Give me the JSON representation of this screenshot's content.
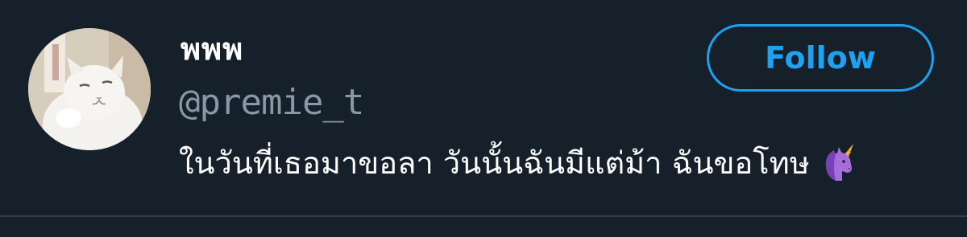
{
  "user": {
    "display_name": "พพพ",
    "handle": "@premie_t",
    "avatar_icon": "cat-avatar"
  },
  "actions": {
    "follow_label": "Follow"
  },
  "tweet": {
    "text": "ในวันที่เธอมาขอลา วันนั้นฉันมีแต่ม้า ฉันขอโทษ",
    "emoji": "unicorn-icon"
  },
  "colors": {
    "background": "#15202b",
    "accent": "#1da1f2",
    "handle": "#8899a6",
    "text": "#ffffff",
    "divider": "#2f3c49"
  }
}
